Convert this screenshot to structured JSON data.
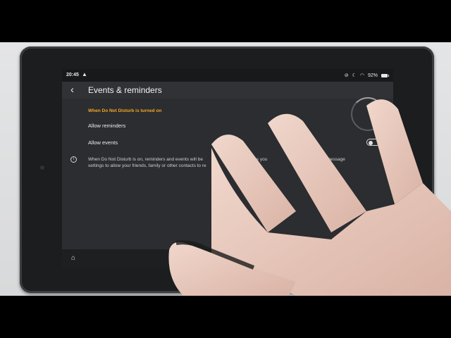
{
  "status_bar": {
    "time": "20:45",
    "battery": "92%",
    "icons": [
      "moon-icon",
      "mute-icon",
      "wifi-icon",
      "battery-icon"
    ]
  },
  "header": {
    "back_label": "‹",
    "title": "Events & reminders"
  },
  "section": {
    "header": "When Do Not Disturb is turned on",
    "rows": [
      {
        "label": "Allow reminders",
        "toggle_visible": false
      },
      {
        "label": "Allow events",
        "toggle_on": false
      }
    ]
  },
  "info": {
    "text_part1": "When Do Not Disturb is on, reminders and events will be",
    "text_part2": "items you",
    "text_part3": "ust message",
    "text_line2": "settings to allow your friends, family or other contacts to re"
  },
  "nav": {
    "home_icon": "⌂"
  },
  "colors": {
    "accent": "#f5a623",
    "screen_bg": "#2b2d30",
    "app_bar": "#303236"
  }
}
